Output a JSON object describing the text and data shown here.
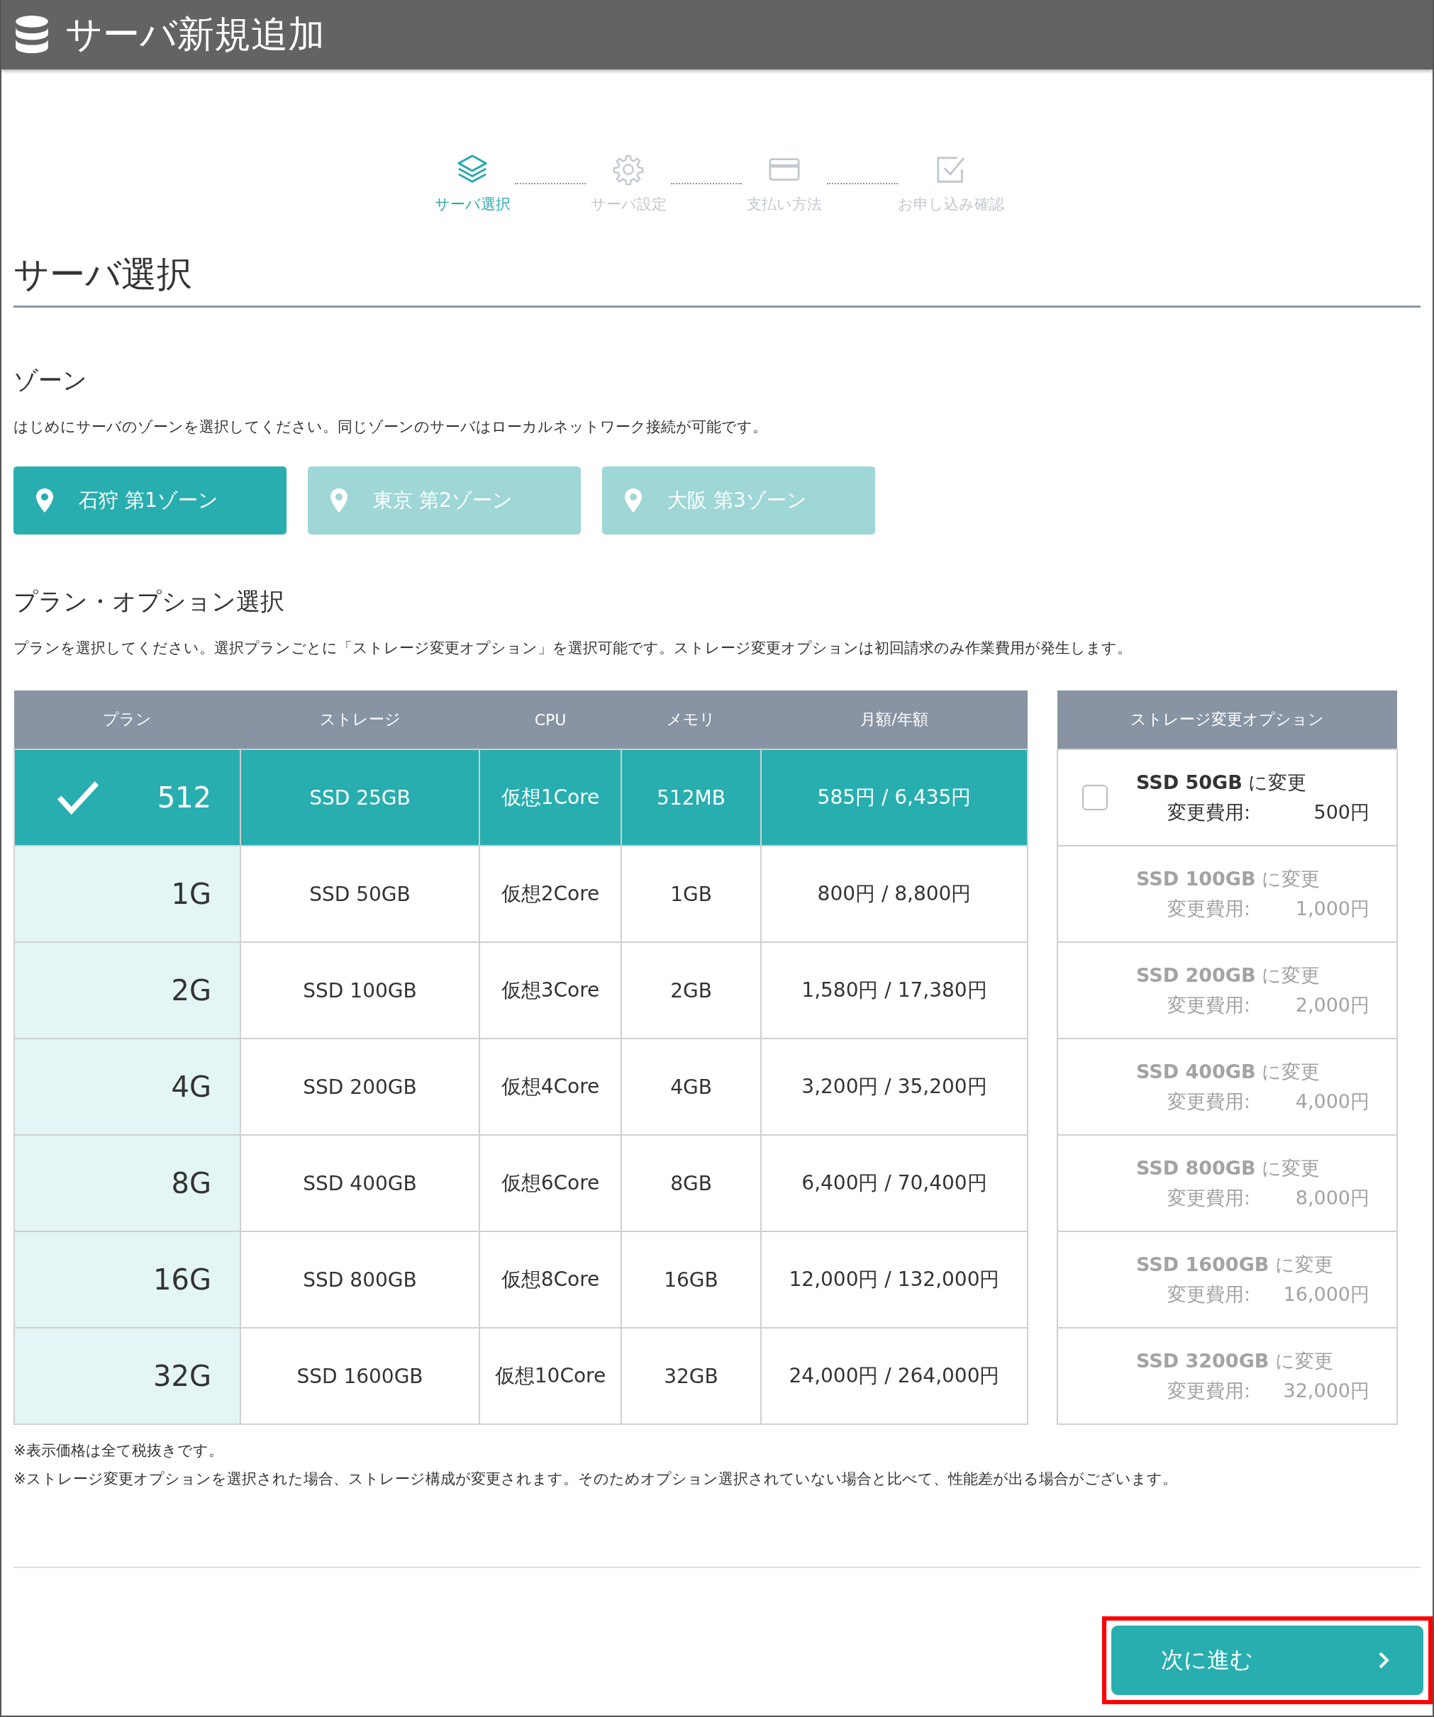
{
  "header": {
    "title": "サーバ新規追加"
  },
  "steps": [
    {
      "kind": "layers",
      "label": "サーバ選択",
      "selected": true
    },
    {
      "kind": "gear",
      "label": "サーバ設定",
      "selected": false
    },
    {
      "kind": "card",
      "label": "支払い方法",
      "selected": false
    },
    {
      "kind": "check",
      "label": "お申し込み確認",
      "selected": false
    }
  ],
  "page_title": "サーバ選択",
  "zone": {
    "heading": "ゾーン",
    "description": "はじめにサーバのゾーンを選択してください。同じゾーンのサーバはローカルネットワーク接続が可能です。",
    "options": [
      {
        "label": "石狩 第1ゾーン",
        "selected": true
      },
      {
        "label": "東京 第2ゾーン",
        "selected": false
      },
      {
        "label": "大阪 第3ゾーン",
        "selected": false
      }
    ]
  },
  "plan": {
    "heading": "プラン・オプション選択",
    "description": "プランを選択してください。選択プランごとに「ストレージ変更オプション」を選択可能です。ストレージ変更オプションは初回請求のみ作業費用が発生します。",
    "columns": [
      "プラン",
      "ストレージ",
      "CPU",
      "メモリ",
      "月額/年額"
    ],
    "rows": [
      {
        "plan": "512",
        "storage": "SSD 25GB",
        "cpu": "仮想1Core",
        "memory": "512MB",
        "price": "585円 / 6,435円",
        "selected": true
      },
      {
        "plan": "1G",
        "storage": "SSD 50GB",
        "cpu": "仮想2Core",
        "memory": "1GB",
        "price": "800円 / 8,800円",
        "selected": false
      },
      {
        "plan": "2G",
        "storage": "SSD 100GB",
        "cpu": "仮想3Core",
        "memory": "2GB",
        "price": "1,580円 / 17,380円",
        "selected": false
      },
      {
        "plan": "4G",
        "storage": "SSD 200GB",
        "cpu": "仮想4Core",
        "memory": "4GB",
        "price": "3,200円 / 35,200円",
        "selected": false
      },
      {
        "plan": "8G",
        "storage": "SSD 400GB",
        "cpu": "仮想6Core",
        "memory": "8GB",
        "price": "6,400円 / 70,400円",
        "selected": false
      },
      {
        "plan": "16G",
        "storage": "SSD 800GB",
        "cpu": "仮想8Core",
        "memory": "16GB",
        "price": "12,000円 / 132,000円",
        "selected": false
      },
      {
        "plan": "32G",
        "storage": "SSD 1600GB",
        "cpu": "仮想10Core",
        "memory": "32GB",
        "price": "24,000円 / 264,000円",
        "selected": false
      }
    ],
    "option_column": "ストレージ変更オプション",
    "options": [
      {
        "label": "**SSD 50GB** に変更",
        "fee_label": "変更費用:",
        "fee": "500円",
        "disabled": false,
        "checked": false
      },
      {
        "label": "**SSD 100GB** に変更",
        "fee_label": "変更費用:",
        "fee": "1,000円",
        "disabled": true
      },
      {
        "label": "**SSD 200GB** に変更",
        "fee_label": "変更費用:",
        "fee": "2,000円",
        "disabled": true
      },
      {
        "label": "**SSD 400GB** に変更",
        "fee_label": "変更費用:",
        "fee": "4,000円",
        "disabled": true
      },
      {
        "label": "**SSD 800GB** に変更",
        "fee_label": "変更費用:",
        "fee": "8,000円",
        "disabled": true
      },
      {
        "label": "**SSD 1600GB** に変更",
        "fee_label": "変更費用:",
        "fee": "16,000円",
        "disabled": true
      },
      {
        "label": "**SSD 3200GB** に変更",
        "fee_label": "変更費用:",
        "fee": "32,000円",
        "disabled": true
      }
    ]
  },
  "notes": [
    "※表示価格は全て税抜きです。",
    "※ストレージ変更オプションを選択された場合、ストレージ構成が変更されます。そのためオプション選択されていない場合と比べて、性能差が出る場合がございます。"
  ],
  "next_button": {
    "label": "次に進む",
    "highlighted": true
  }
}
